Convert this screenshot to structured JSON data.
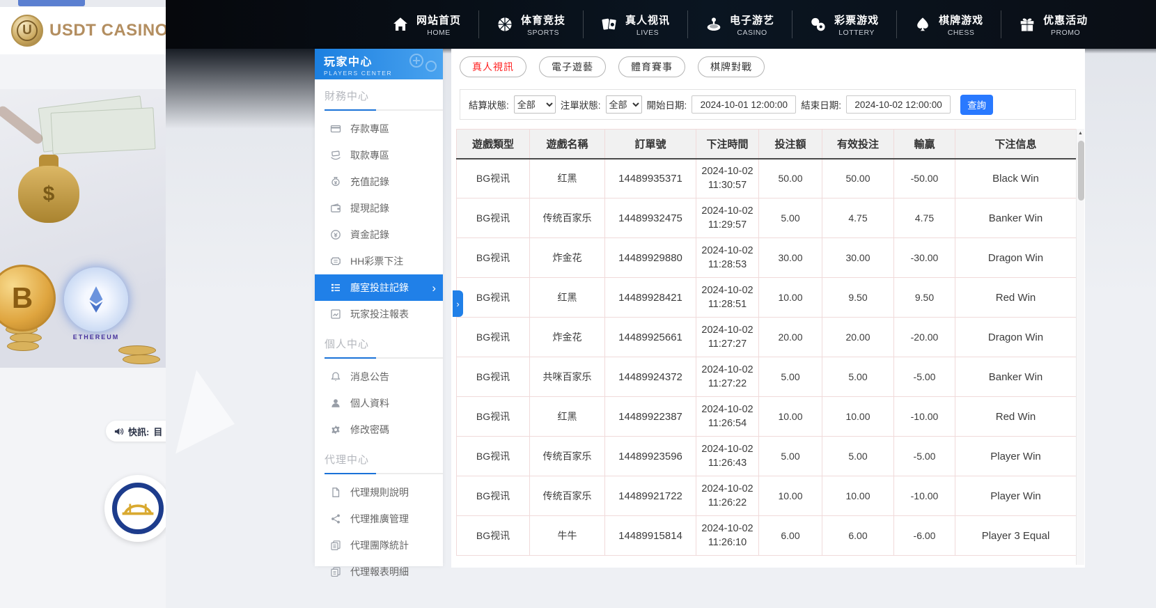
{
  "brand": {
    "name": "USDT CASINO",
    "initial": "U"
  },
  "topnav": {
    "items": [
      {
        "zh": "网站首页",
        "en": "HOME",
        "icon": "home-icon"
      },
      {
        "zh": "体育竞技",
        "en": "SPORTS",
        "icon": "basketball-icon"
      },
      {
        "zh": "真人视讯",
        "en": "LIVES",
        "icon": "cards-icon"
      },
      {
        "zh": "电子游艺",
        "en": "CASINO",
        "icon": "roulette-icon"
      },
      {
        "zh": "彩票游戏",
        "en": "LOTTERY",
        "icon": "lottery-balls-icon"
      },
      {
        "zh": "棋牌游戏",
        "en": "CHESS",
        "icon": "spade-icon"
      },
      {
        "zh": "优惠活动",
        "en": "PROMO",
        "icon": "gift-icon"
      }
    ]
  },
  "sidebar": {
    "header": {
      "title": "玩家中心",
      "subtitle": "PLAYERS CENTER"
    },
    "sections": [
      {
        "title": "財務中心",
        "items": [
          {
            "label": "存款專區",
            "icon": "bank-card-icon"
          },
          {
            "label": "取款專區",
            "icon": "withdraw-icon"
          },
          {
            "label": "充值記錄",
            "icon": "moneybag-icon"
          },
          {
            "label": "提現記錄",
            "icon": "wallet-icon"
          },
          {
            "label": "資金記錄",
            "icon": "funds-icon"
          },
          {
            "label": "HH彩票下注",
            "icon": "ticket-icon"
          },
          {
            "label": "廳室投註記錄",
            "icon": "records-icon",
            "active": true
          },
          {
            "label": "玩家投注報表",
            "icon": "report-icon"
          }
        ]
      },
      {
        "title": "個人中心",
        "items": [
          {
            "label": "消息公告",
            "icon": "bell-icon"
          },
          {
            "label": "個人資料",
            "icon": "user-icon"
          },
          {
            "label": "修改密碼",
            "icon": "gear-icon"
          }
        ]
      },
      {
        "title": "代理中心",
        "items": [
          {
            "label": "代理規則說明",
            "icon": "doc-icon"
          },
          {
            "label": "代理推廣管理",
            "icon": "share-icon"
          },
          {
            "label": "代理團隊統計",
            "icon": "team-stats-icon"
          },
          {
            "label": "代理報表明細",
            "icon": "report-detail-icon"
          }
        ]
      }
    ]
  },
  "main": {
    "tabs": [
      {
        "key": "live",
        "label": "真人視訊",
        "active": true
      },
      {
        "key": "egame",
        "label": "電子遊藝"
      },
      {
        "key": "sports",
        "label": "體育賽事"
      },
      {
        "key": "chess",
        "label": "棋牌對戰"
      }
    ],
    "filters": {
      "settle_label": "結算狀態:",
      "settle_value": "全部",
      "order_label": "注單狀態:",
      "order_value": "全部",
      "start_label": "開始日期:",
      "start_value": "2024-10-01 12:00:00",
      "end_label": "結束日期:",
      "end_value": "2024-10-02 12:00:00",
      "search_label": "查詢"
    },
    "table": {
      "headers": [
        "遊戲類型",
        "遊戲名稱",
        "訂單號",
        "下注時間",
        "投注額",
        "有效投注",
        "輸贏",
        "下注信息"
      ],
      "rows": [
        [
          "BG视讯",
          "红黑",
          "14489935371",
          "2024-10-02 11:30:57",
          "50.00",
          "50.00",
          "-50.00",
          "Black Win"
        ],
        [
          "BG视讯",
          "传统百家乐",
          "14489932475",
          "2024-10-02 11:29:57",
          "5.00",
          "4.75",
          "4.75",
          "Banker Win"
        ],
        [
          "BG视讯",
          "炸金花",
          "14489929880",
          "2024-10-02 11:28:53",
          "30.00",
          "30.00",
          "-30.00",
          "Dragon Win"
        ],
        [
          "BG视讯",
          "红黑",
          "14489928421",
          "2024-10-02 11:28:51",
          "10.00",
          "9.50",
          "9.50",
          "Red Win"
        ],
        [
          "BG视讯",
          "炸金花",
          "14489925661",
          "2024-10-02 11:27:27",
          "20.00",
          "20.00",
          "-20.00",
          "Dragon Win"
        ],
        [
          "BG视讯",
          "共咪百家乐",
          "14489924372",
          "2024-10-02 11:27:22",
          "5.00",
          "5.00",
          "-5.00",
          "Banker Win"
        ],
        [
          "BG视讯",
          "红黑",
          "14489922387",
          "2024-10-02 11:26:54",
          "10.00",
          "10.00",
          "-10.00",
          "Red Win"
        ],
        [
          "BG视讯",
          "传统百家乐",
          "14489923596",
          "2024-10-02 11:26:43",
          "5.00",
          "5.00",
          "-5.00",
          "Player Win"
        ],
        [
          "BG视讯",
          "传统百家乐",
          "14489921722",
          "2024-10-02 11:26:22",
          "10.00",
          "10.00",
          "-10.00",
          "Player Win"
        ],
        [
          "BG视讯",
          "牛牛",
          "14489915814",
          "2024-10-02 11:26:10",
          "6.00",
          "6.00",
          "-6.00",
          "Player 3 Equal"
        ]
      ]
    }
  },
  "marquee": {
    "label": "快訊:",
    "partial": "目"
  },
  "hero": {
    "eth_caption": "ETHEREUM",
    "btc_symbol": "B",
    "bag_symbol": "$"
  },
  "colors": {
    "accent_blue": "#2979ff",
    "sidebar_active": "#2080e8",
    "active_tab_red": "#ff1f1f",
    "nav_bg": "#0a1521",
    "table_border": "#f0dada",
    "gold": "#b38e60"
  }
}
